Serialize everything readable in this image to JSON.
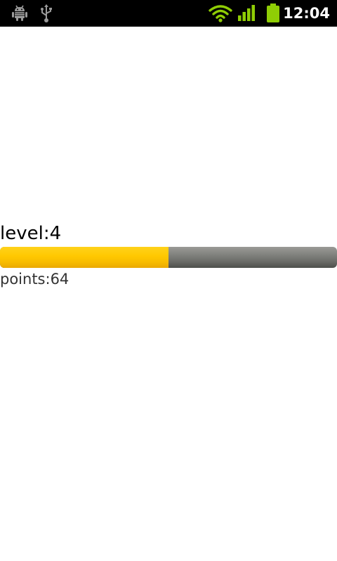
{
  "status_bar": {
    "time": "12:04",
    "icons": [
      "android-debug-icon",
      "usb-icon",
      "wifi-icon",
      "signal-icon",
      "battery-icon"
    ],
    "accent_color": "#8fcd05"
  },
  "main": {
    "level_text": "level:4",
    "progress_fraction": 0.5,
    "points_text": "points:64",
    "progress_colors": {
      "fill": "#ffc800",
      "track": "#7c7d79"
    }
  }
}
